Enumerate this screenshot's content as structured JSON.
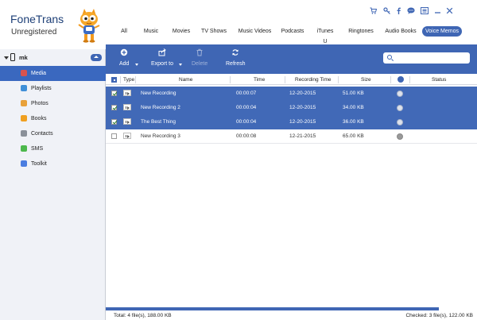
{
  "app": {
    "name": "FoneTrans",
    "status": "Unregistered"
  },
  "device": {
    "name": "mk"
  },
  "sidebar": {
    "items": [
      {
        "label": "Media",
        "color": "#d9534f"
      },
      {
        "label": "Playlists",
        "color": "#3f8fd8"
      },
      {
        "label": "Photos",
        "color": "#e8a13a"
      },
      {
        "label": "Books",
        "color": "#f0a020"
      },
      {
        "label": "Contacts",
        "color": "#8a9099"
      },
      {
        "label": "SMS",
        "color": "#4cb84c"
      },
      {
        "label": "Toolkit",
        "color": "#4a7de0"
      }
    ]
  },
  "top_icons": [
    "cart-icon",
    "key-icon",
    "facebook-icon",
    "chat-icon",
    "menu-icon",
    "minimize-icon",
    "close-icon"
  ],
  "tabs": [
    {
      "label": "All"
    },
    {
      "label": "Music"
    },
    {
      "label": "Movies"
    },
    {
      "label": "TV Shows"
    },
    {
      "label": "Music Videos"
    },
    {
      "label": "Podcasts"
    },
    {
      "label": "iTunes U"
    },
    {
      "label": "Ringtones"
    },
    {
      "label": "Audio Books"
    },
    {
      "label": "Voice Memos"
    }
  ],
  "active_tab": "Voice Memos",
  "toolbar": {
    "add": "Add",
    "export": "Export to",
    "delete": "Delete",
    "refresh": "Refresh"
  },
  "search": {
    "placeholder": ""
  },
  "table": {
    "headers": {
      "type": "Type",
      "name": "Name",
      "time": "Time",
      "recording_time": "Recording Time",
      "size": "Size",
      "status": "Status"
    },
    "rows": [
      {
        "name": "New Recording",
        "time": "00:00:07",
        "recording_time": "12-20-2015",
        "size": "51.00 KB",
        "checked": true
      },
      {
        "name": "New Recording 2",
        "time": "00:00:04",
        "recording_time": "12-20-2015",
        "size": "34.00 KB",
        "checked": true
      },
      {
        "name": "The Best Thing",
        "time": "00:00:04",
        "recording_time": "12-20-2015",
        "size": "36.00 KB",
        "checked": true
      },
      {
        "name": "New Recording 3",
        "time": "00:00:08",
        "recording_time": "12-21-2015",
        "size": "65.00 KB",
        "checked": false
      }
    ]
  },
  "footer": {
    "total": "Total: 4 file(s), 188.00 KB",
    "checked": "Checked: 3 file(s), 122.00 KB"
  },
  "colors": {
    "accent": "#3f66b4",
    "selection": "#4169b7"
  }
}
